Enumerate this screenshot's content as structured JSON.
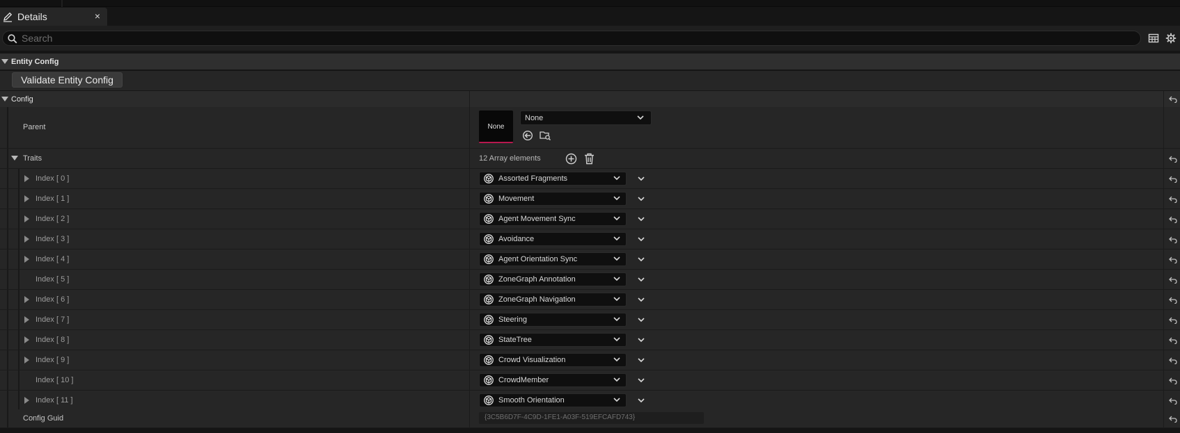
{
  "tab": {
    "title": "Details",
    "close": "×"
  },
  "search": {
    "placeholder": "Search",
    "value": ""
  },
  "categories": {
    "entity_config": "Entity Config",
    "config": "Config"
  },
  "validate_button": "Validate Entity Config",
  "parent": {
    "label": "Parent",
    "thumbnail_text": "None",
    "asset_value": "None"
  },
  "traits": {
    "label": "Traits",
    "count_text": "12 Array elements",
    "items": [
      {
        "index": "Index [ 0 ]",
        "value": "Assorted Fragments",
        "expandable": true
      },
      {
        "index": "Index [ 1 ]",
        "value": "Movement",
        "expandable": true
      },
      {
        "index": "Index [ 2 ]",
        "value": "Agent Movement Sync",
        "expandable": true
      },
      {
        "index": "Index [ 3 ]",
        "value": "Avoidance",
        "expandable": true
      },
      {
        "index": "Index [ 4 ]",
        "value": "Agent Orientation Sync",
        "expandable": true
      },
      {
        "index": "Index [ 5 ]",
        "value": "ZoneGraph Annotation",
        "expandable": false
      },
      {
        "index": "Index [ 6 ]",
        "value": "ZoneGraph Navigation",
        "expandable": true
      },
      {
        "index": "Index [ 7 ]",
        "value": "Steering",
        "expandable": true
      },
      {
        "index": "Index [ 8 ]",
        "value": "StateTree",
        "expandable": true
      },
      {
        "index": "Index [ 9 ]",
        "value": "Crowd Visualization",
        "expandable": true
      },
      {
        "index": "Index [ 10 ]",
        "value": "CrowdMember",
        "expandable": false
      },
      {
        "index": "Index [ 11 ]",
        "value": "Smooth Orientation",
        "expandable": true
      }
    ]
  },
  "config_guid": {
    "label": "Config Guid",
    "value": "{3C5B6D7F-4C9D-1FE1-A03F-519EFCAFD743}"
  },
  "colors": {
    "background": "#262626",
    "header": "#2f2f2f",
    "field": "#0f0f0f",
    "thumbnail_accent": "#b8184e",
    "text": "#c6c6c6"
  },
  "icons": {
    "tab": "pencil-icon",
    "search": "search-icon",
    "table_view": "table-icon",
    "settings": "gear-icon",
    "reset": "reset-to-default-icon",
    "trait": "trait-class-icon",
    "add": "add-element-icon",
    "delete": "delete-icon",
    "use_selected": "use-selected-icon",
    "browse": "browse-folder-icon"
  }
}
